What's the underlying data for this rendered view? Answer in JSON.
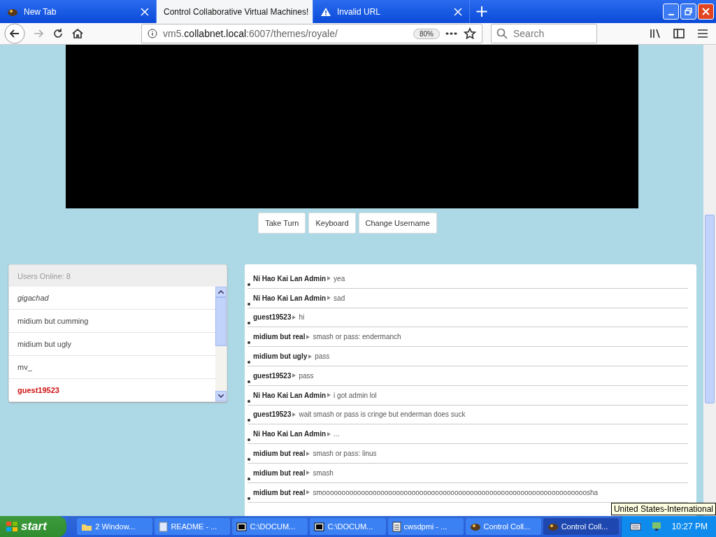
{
  "tabs": [
    {
      "title": "New Tab",
      "kind": "browser",
      "selected": false
    },
    {
      "title": "Control Collaborative Virtual Machines!",
      "kind": "plain",
      "selected": true
    },
    {
      "title": "Invalid URL",
      "kind": "warning",
      "selected": false
    }
  ],
  "address": {
    "host_prefix": "vm5.",
    "host": "collabnet.local",
    "path": ":6007/themes/royale/",
    "zoom": "80%"
  },
  "search": {
    "placeholder": "Search"
  },
  "vm_buttons": [
    "Take Turn",
    "Keyboard",
    "Change Username"
  ],
  "users": {
    "title": "Users Online: 8",
    "items": [
      {
        "name": "gigachad",
        "kind": "italic"
      },
      {
        "name": "midium but cumming",
        "kind": "normal"
      },
      {
        "name": "midium but ugly",
        "kind": "normal"
      },
      {
        "name": "mv_",
        "kind": "normal"
      },
      {
        "name": "guest19523",
        "kind": "self"
      }
    ]
  },
  "chat": [
    {
      "user": "Ni Hao Kai Lan Admin",
      "message": "yea"
    },
    {
      "user": "Ni Hao Kai Lan Admin",
      "message": "sad"
    },
    {
      "user": "guest19523",
      "message": "hi"
    },
    {
      "user": "midium but real",
      "message": "smash or pass: endermanch"
    },
    {
      "user": "midium but ugly",
      "message": "pass"
    },
    {
      "user": "guest19523",
      "message": "pass"
    },
    {
      "user": "Ni Hao Kai Lan Admin",
      "message": "i got admin lol"
    },
    {
      "user": "guest19523",
      "message": "wait smash or pass is cringe but enderman does suck"
    },
    {
      "user": "Ni Hao Kai Lan Admin",
      "message": "..."
    },
    {
      "user": "midium but real",
      "message": "smash or pass: linus"
    },
    {
      "user": "midium but real",
      "message": "smash"
    },
    {
      "user": "midium but real",
      "message": "smoooooooooooooooooooooooooooooooooooooooooooooooooooooooooooooooooooosha"
    }
  ],
  "tooltip": "United States-International",
  "taskbar": {
    "start": "start",
    "items": [
      {
        "label": "2 Window...",
        "kind": "folder",
        "selected": false
      },
      {
        "label": "README - ...",
        "kind": "doc",
        "selected": false
      },
      {
        "label": "C:\\DOCUM...",
        "kind": "zip",
        "selected": false
      },
      {
        "label": "C:\\DOCUM...",
        "kind": "zip",
        "selected": false
      },
      {
        "label": "cwsdpmi - ...",
        "kind": "note",
        "selected": false
      },
      {
        "label": "Control Coll...",
        "kind": "browser",
        "selected": false
      },
      {
        "label": "Control Coll...",
        "kind": "browser",
        "selected": true
      }
    ],
    "clock": "10:27 PM"
  }
}
